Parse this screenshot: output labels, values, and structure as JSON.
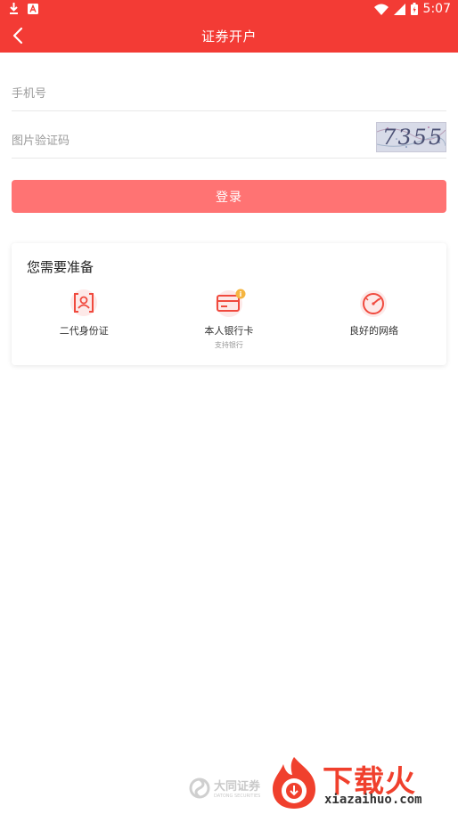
{
  "status_bar": {
    "time": "5:07",
    "icons": [
      "download-icon",
      "a-icon",
      "wifi-icon",
      "signal-icon",
      "battery-icon"
    ]
  },
  "header": {
    "title": "证券开户",
    "back_icon": "chevron-left-icon",
    "color": "#f33b35"
  },
  "form": {
    "phone_placeholder": "手机号",
    "captcha_placeholder": "图片验证码",
    "captcha_code": "7355",
    "login_label": "登录",
    "button_color": "#ff7373"
  },
  "prepare": {
    "title": "您需要准备",
    "items": [
      {
        "label": "二代身份证",
        "sub": "",
        "icon": "id-card-icon"
      },
      {
        "label": "本人银行卡",
        "sub": "支持银行",
        "icon": "bank-card-icon"
      },
      {
        "label": "良好的网络",
        "sub": "",
        "icon": "speedometer-icon"
      }
    ]
  },
  "footer": {
    "brand": "大同证券",
    "brand_sub": "DATONG SECURITIES"
  },
  "watermark": {
    "text": "下载火",
    "url": "xiazaihuo.com"
  }
}
